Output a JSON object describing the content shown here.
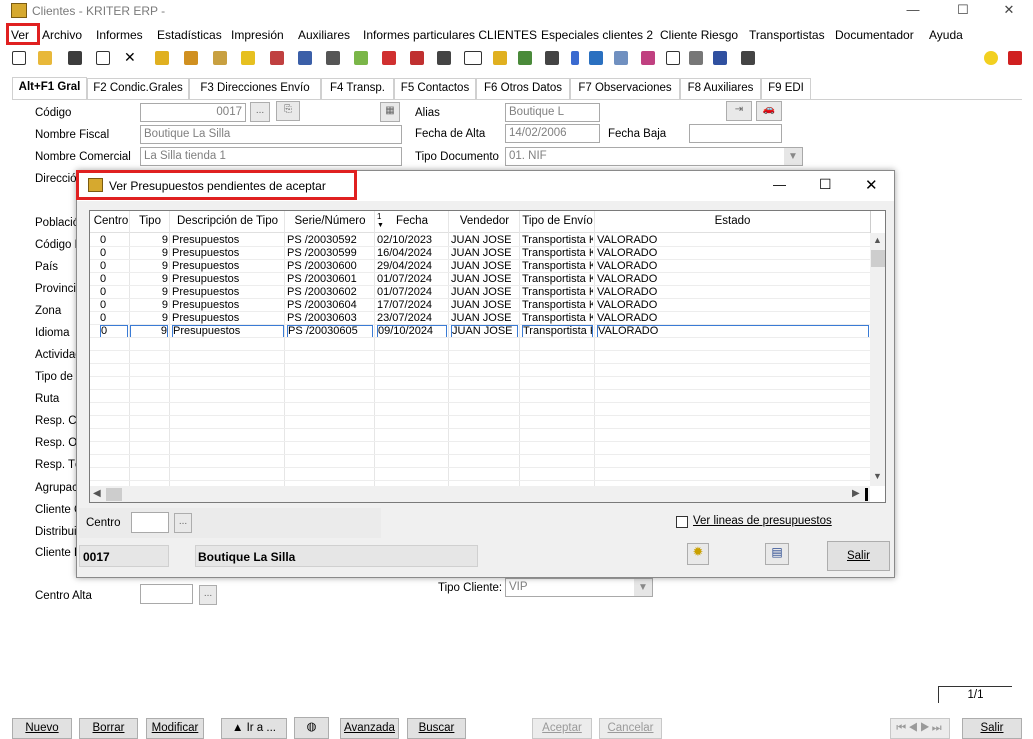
{
  "window": {
    "title": "Clientes - KRITER ERP -"
  },
  "menu": [
    "Ver",
    "Archivo",
    "Informes",
    "Estadísticas",
    "Impresión",
    "Auxiliares",
    "Informes particulares CLIENTES",
    "Especiales clientes 2",
    "Cliente Riesgo",
    "Transportistas",
    "Documentador",
    "Ayuda"
  ],
  "tabs": [
    "Alt+F1 Gral",
    "F2 Condic.Grales",
    "F3 Direcciones Envío",
    "F4 Transp.",
    "F5 Contactos",
    "F6 Otros Datos",
    "F7 Observaciones",
    "F8 Auxiliares",
    "F9 EDI"
  ],
  "form": {
    "codigo_label": "Código",
    "codigo_value": "0017",
    "nombre_fiscal_label": "Nombre Fiscal",
    "nombre_fiscal_value": "Boutique La Silla",
    "nombre_comercial_label": "Nombre Comercial",
    "nombre_comercial_value": "La Silla tienda 1",
    "alias_label": "Alias",
    "alias_value": "Boutique L",
    "fecha_alta_label": "Fecha de Alta",
    "fecha_alta_value": "14/02/2006",
    "fecha_baja_label": "Fecha Baja",
    "fecha_baja_value": "",
    "tipo_documento_label": "Tipo Documento",
    "tipo_documento_value": "01. NIF",
    "side_labels": [
      "Direcció",
      "Població",
      "Código P",
      "País",
      "Provincia",
      "Zona",
      "Idioma",
      "Actividad",
      "Tipo de E",
      "Ruta",
      "Resp. Co",
      "Resp. Op",
      "Resp. Té",
      "Agrupaci",
      "Cliente G",
      "Distribui",
      "Cliente F"
    ],
    "centro_alta_label": "Centro Alta",
    "tipo_cliente_label": "Tipo Cliente:",
    "tipo_cliente_value": "VIP"
  },
  "dialog": {
    "title": "Ver Presupuestos pendientes de aceptar",
    "columns": [
      "Centro",
      "Tipo",
      "Descripción de Tipo",
      "Serie/Número",
      "Fecha",
      "Vendedor",
      "Tipo de Envío",
      "Estado"
    ],
    "sort_marker": "1",
    "rows": [
      [
        "0",
        "9",
        "Presupuestos",
        "PS /20030592",
        "02/10/2023",
        "JUAN JOSE",
        "Transportista K",
        "VALORADO"
      ],
      [
        "0",
        "9",
        "Presupuestos",
        "PS /20030599",
        "16/04/2024",
        "JUAN JOSE",
        "Transportista K",
        "VALORADO"
      ],
      [
        "0",
        "9",
        "Presupuestos",
        "PS /20030600",
        "29/04/2024",
        "JUAN JOSE",
        "Transportista K",
        "VALORADO"
      ],
      [
        "0",
        "9",
        "Presupuestos",
        "PS /20030601",
        "01/07/2024",
        "JUAN JOSE",
        "Transportista K",
        "VALORADO"
      ],
      [
        "0",
        "9",
        "Presupuestos",
        "PS /20030602",
        "01/07/2024",
        "JUAN JOSE",
        "Transportista K",
        "VALORADO"
      ],
      [
        "0",
        "9",
        "Presupuestos",
        "PS /20030604",
        "17/07/2024",
        "JUAN JOSE",
        "Transportista K",
        "VALORADO"
      ],
      [
        "0",
        "9",
        "Presupuestos",
        "PS /20030603",
        "23/07/2024",
        "JUAN JOSE",
        "Transportista K",
        "VALORADO"
      ],
      [
        "0",
        "9",
        "Presupuestos",
        "PS /20030605",
        "09/10/2024",
        "JUAN JOSE",
        "Transportista K",
        "VALORADO"
      ]
    ],
    "centro_label": "Centro",
    "centro_value": "",
    "ver_lineas_label": "Ver lineas de presupuestos",
    "code": "0017",
    "name": "Boutique La Silla",
    "salir": "Salir"
  },
  "bottom": {
    "buttons": [
      "Nuevo",
      "Borrar",
      "Modificar",
      "▲ Ir a ...",
      "Avanzada",
      "Buscar",
      "Aceptar",
      "Cancelar",
      "Salir"
    ],
    "page": "1/1"
  },
  "colors": {
    "highlight": "#e02020",
    "selection": "#3a7bd5"
  }
}
